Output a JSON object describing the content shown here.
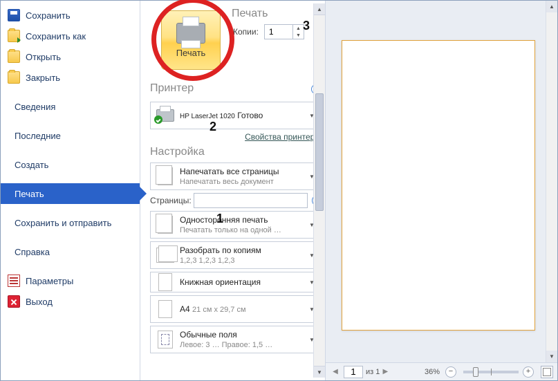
{
  "nav": {
    "save": "Сохранить",
    "saveAs": "Сохранить как",
    "open": "Открыть",
    "close": "Закрыть",
    "info": "Сведения",
    "recent": "Последние",
    "new_": "Создать",
    "print": "Печать",
    "saveSend": "Сохранить и отправить",
    "help": "Справка",
    "options": "Параметры",
    "exit": "Выход"
  },
  "print": {
    "headerPrint": "Печать",
    "bigButton": "Печать",
    "copiesLabel": "Копии:",
    "copiesValue": "1",
    "printerHeader": "Принтер",
    "printerName": "HP LaserJet 1020",
    "printerState": "Готово",
    "printerProps": "Свойства принтера",
    "settingsHeader": "Настройка",
    "allPages": {
      "t1": "Напечатать все страницы",
      "t2": "Напечатать весь документ"
    },
    "pagesLabel": "Страницы:",
    "pagesValue": "",
    "oneSided": {
      "t1": "Односторонняя печать",
      "t2": "Печатать только на одной …"
    },
    "collate": {
      "t1": "Разобрать по копиям",
      "t2": "1,2,3   1,2,3   1,2,3"
    },
    "orient": {
      "t1": "Книжная ориентация"
    },
    "paper": {
      "t1": "A4",
      "t2": "21 см x 29,7 см"
    },
    "margins": {
      "t1": "Обычные поля",
      "t2": "Левое: 3 …   Правое: 1,5 …"
    }
  },
  "annotations": {
    "one": "1",
    "two": "2",
    "three": "3"
  },
  "preview": {
    "pageCurrent": "1",
    "pageOf": "из 1",
    "zoom": "36%"
  }
}
